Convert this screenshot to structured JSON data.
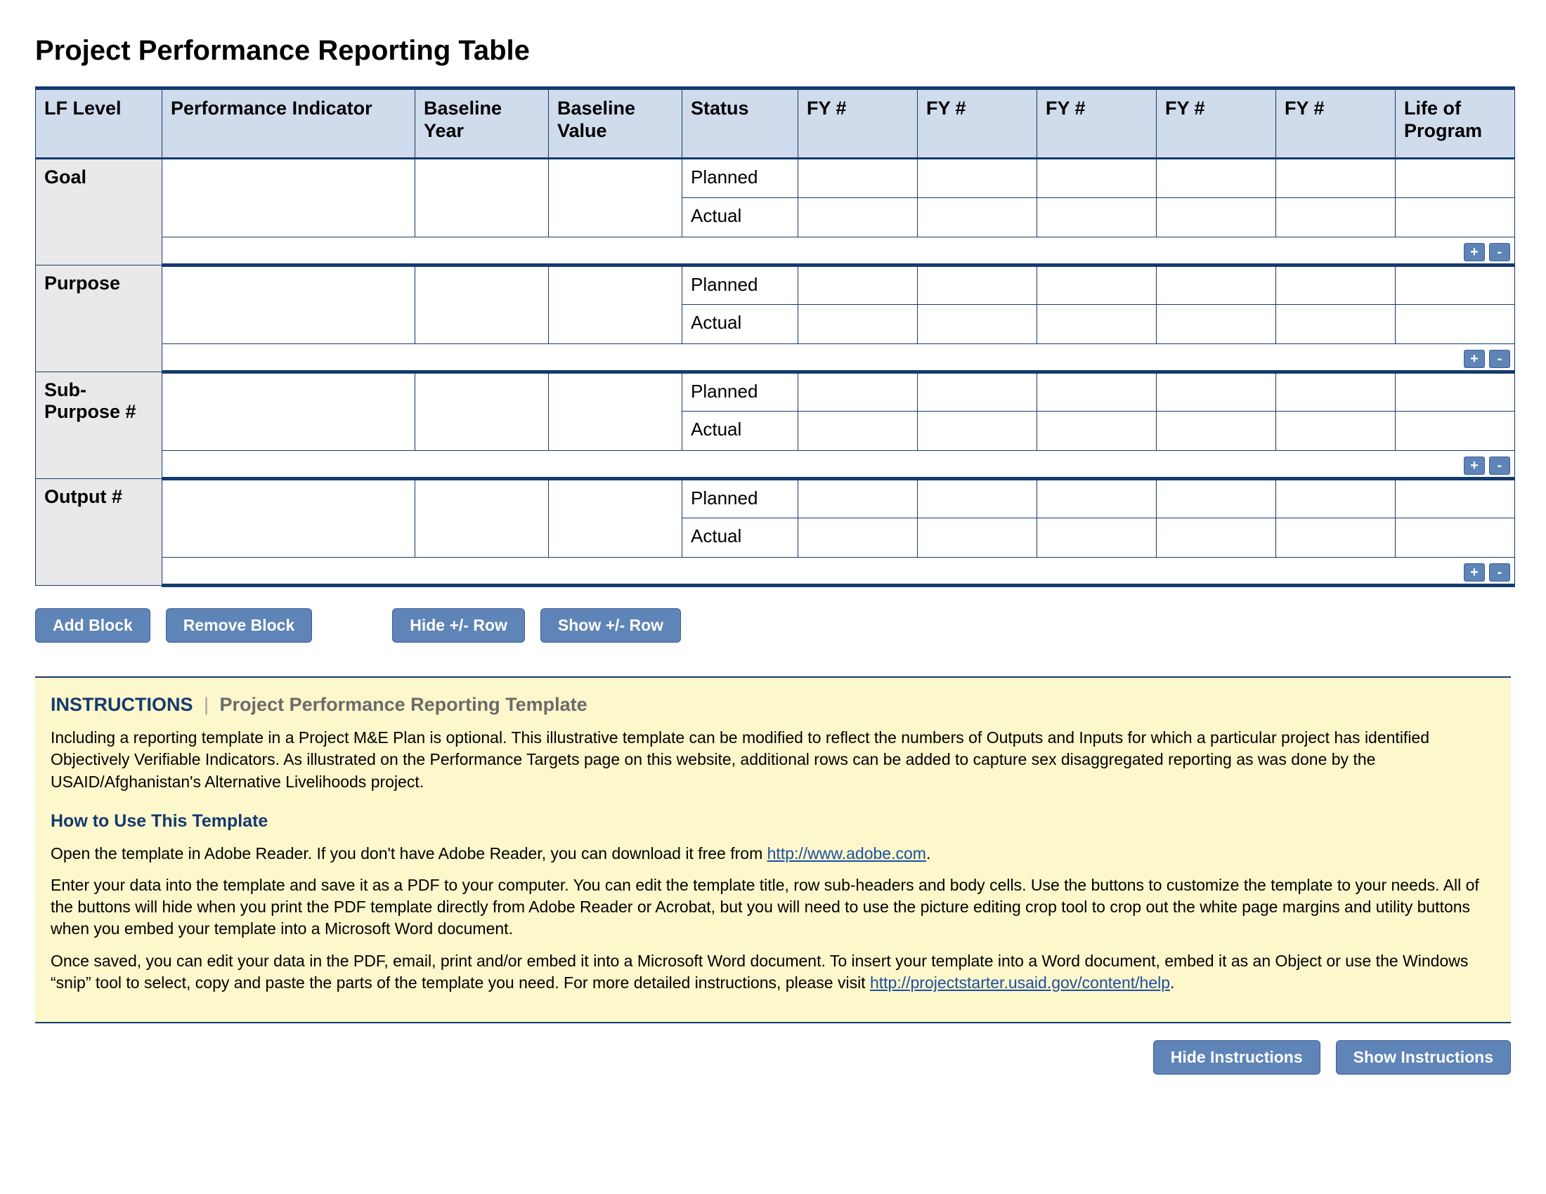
{
  "title": "Project Performance Reporting Table",
  "columns": [
    "LF Level",
    "Performance Indicator",
    "Baseline Year",
    "Baseline Value",
    "Status",
    "FY #",
    "FY #",
    "FY #",
    "FY #",
    "FY #",
    "Life of Program"
  ],
  "status_labels": {
    "planned": "Planned",
    "actual": "Actual"
  },
  "groups": [
    {
      "lf": "Goal"
    },
    {
      "lf": "Purpose"
    },
    {
      "lf": "Sub-Purpose #"
    },
    {
      "lf": "Output #"
    }
  ],
  "pm": {
    "plus": "+",
    "minus": "-"
  },
  "toolbar": {
    "add_block": "Add Block",
    "remove_block": "Remove Block",
    "hide_row": "Hide +/- Row",
    "show_row": "Show +/- Row"
  },
  "instructions": {
    "heading_label": "INSTRUCTIONS",
    "heading_sub": "Project Performance Reporting Template",
    "p1": "Including a reporting template in a Project M&E Plan is optional. This illustrative template can be modified to reflect the numbers of Outputs and Inputs for which a particular project has identified Objectively Verifiable Indicators. As illustrated on the Performance Targets page on this website, additional rows can be added to capture sex disaggregated reporting as was done by the USAID/Afghanistan's Alternative Livelihoods project.",
    "howto_heading": "How to Use This Template",
    "p2a": "Open the template in Adobe Reader. If you don't have Adobe Reader, you can download it free from ",
    "p2_link_text": "http://www.adobe.com",
    "p2b": ".",
    "p3": "Enter your data into the template and save it as a PDF to your computer. You can edit the template title, row sub-headers and body cells. Use the buttons to customize the template to your needs. All of the buttons will hide when you print the PDF template directly from Adobe Reader or Acrobat, but you will need to use the picture editing crop tool to crop out the white page margins and utility buttons when you embed your template into a Microsoft Word document.",
    "p4a": "Once saved, you can edit your data in the PDF, email, print and/or embed it into a Microsoft Word document. To insert your template into a Word document, embed it as an Object or use the Windows “snip” tool to select, copy and paste the parts of the template you need. For more detailed instructions, please visit ",
    "p4_link_text": "http://projectstarter.usaid.gov/content/help",
    "p4b": "."
  },
  "footer": {
    "hide": "Hide Instructions",
    "show": "Show Instructions"
  }
}
